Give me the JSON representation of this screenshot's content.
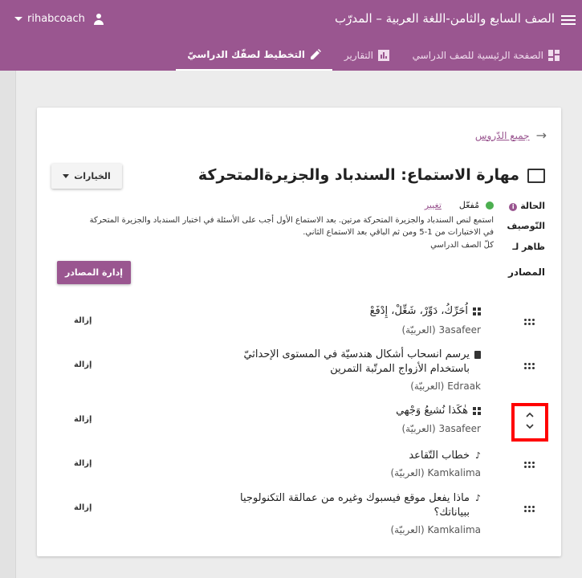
{
  "appbar": {
    "title": "الصف السابع والثامن-اللغة العربية – المدرّب",
    "username": "rihabcoach"
  },
  "tabs": [
    {
      "label": "الصفحة الرئيسية للصف الدراسي",
      "active": false
    },
    {
      "label": "التقارير",
      "active": false
    },
    {
      "label": "التخطيط لصفّك الدراسيّ",
      "active": true
    }
  ],
  "lesson": {
    "back_link": "جميع الدّروس",
    "title": "مهارة الاستماع: السندباد والجزيرةالمتحركة",
    "options_label": "الخيارات",
    "status_label": "الحالة",
    "status_value": "مُفعّل",
    "change_label": "تغيير",
    "description_label": "التّوصيف",
    "description": "استمع لنص السندباد والجزيرة المتحركة مرتين. بعد الاستماع الأول أجب على الأسئلة في اختبار السندباد والجزيرة المتحركة في الاختبارات من 1-5 ومن ثم الباقي بعد الاستماع الثاني.",
    "visible_to_label": "ظاهر لـ",
    "visible_to_value": "كلّ الصف الدراسي",
    "resources_label": "المصادر",
    "manage_button": "إدارة المصادر"
  },
  "resources": [
    {
      "title": "اُحَرِّكُ، دَوِّرْ، شَغِّلْ، إِدْفَعْ",
      "source": "3asafeer",
      "lang": "(العربيّة)",
      "icon": "grid-icon",
      "remove": "إزالة"
    },
    {
      "title": "يرسم انسحاب أشكال هندسيّة في المستوى الإحداثيّ باستخدام الأزواج المرتّبة التمرين",
      "source": "Edraak",
      "lang": "(العربيّة)",
      "icon": "document-icon",
      "remove": "إزالة"
    },
    {
      "title": "هٰكَذا نُشيعُ وَجْهي",
      "source": "3asafeer",
      "lang": "(العربيّة)",
      "icon": "grid-icon",
      "remove": "إزالة"
    },
    {
      "title": "خطاب التّقاعد",
      "source": "Kamkalima",
      "lang": "(العربيّة)",
      "icon": "music-note-icon",
      "remove": "إزالة"
    },
    {
      "title": "ماذا يفعل موقع فيسبوك وغيره من عمالقة التكنولوجيا ببياناتك؟",
      "source": "Kamkalima",
      "lang": "(العربيّة)",
      "icon": "music-note-icon",
      "remove": "إزالة"
    }
  ],
  "colors": {
    "primary": "#9a5690",
    "status_active": "#4caf50",
    "highlight": "#ff0000"
  }
}
